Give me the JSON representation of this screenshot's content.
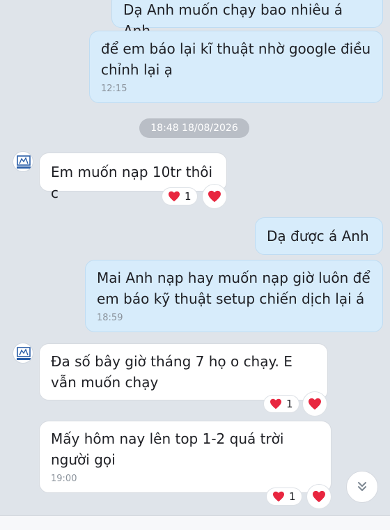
{
  "colors": {
    "background": "#dfe4ea",
    "outgoing_bubble": "#d7ecfb",
    "incoming_bubble": "#ffffff",
    "date_pill": "#b9bec6",
    "heart": "#e8263f"
  },
  "messages": [
    {
      "id": "m1",
      "direction": "outgoing",
      "text": "Dạ Anh muốn chạy bao nhiêu á Anh"
    },
    {
      "id": "m2",
      "direction": "outgoing",
      "text": "để em báo lại kĩ thuật nhờ google điều chỉnh lại ạ",
      "time": "12:15"
    },
    {
      "id": "date",
      "type": "date_separator",
      "text": "18:48 18/08/2026"
    },
    {
      "id": "m3",
      "direction": "incoming",
      "text": "Em muốn nạp 10tr thôi c",
      "reaction_count": "1"
    },
    {
      "id": "m4",
      "direction": "outgoing",
      "text": "Dạ được á Anh"
    },
    {
      "id": "m5",
      "direction": "outgoing",
      "text": "Mai Anh nạp hay muốn nạp giờ luôn để em báo kỹ thuật setup chiến dịch lại á",
      "time": "18:59"
    },
    {
      "id": "m6",
      "direction": "incoming",
      "text": "Đa số bây giờ tháng 7 họ o chạy. E vẫn muốn chạy",
      "reaction_count": "1"
    },
    {
      "id": "m7",
      "direction": "incoming",
      "text": "Mấy hôm nay lên top 1-2 quá trời người gọi",
      "time": "19:00",
      "reaction_count": "1"
    }
  ],
  "icons": {
    "reaction": "heart-icon",
    "scroll": "chevron-double-down-icon",
    "avatar": "company-logo-avatar"
  }
}
